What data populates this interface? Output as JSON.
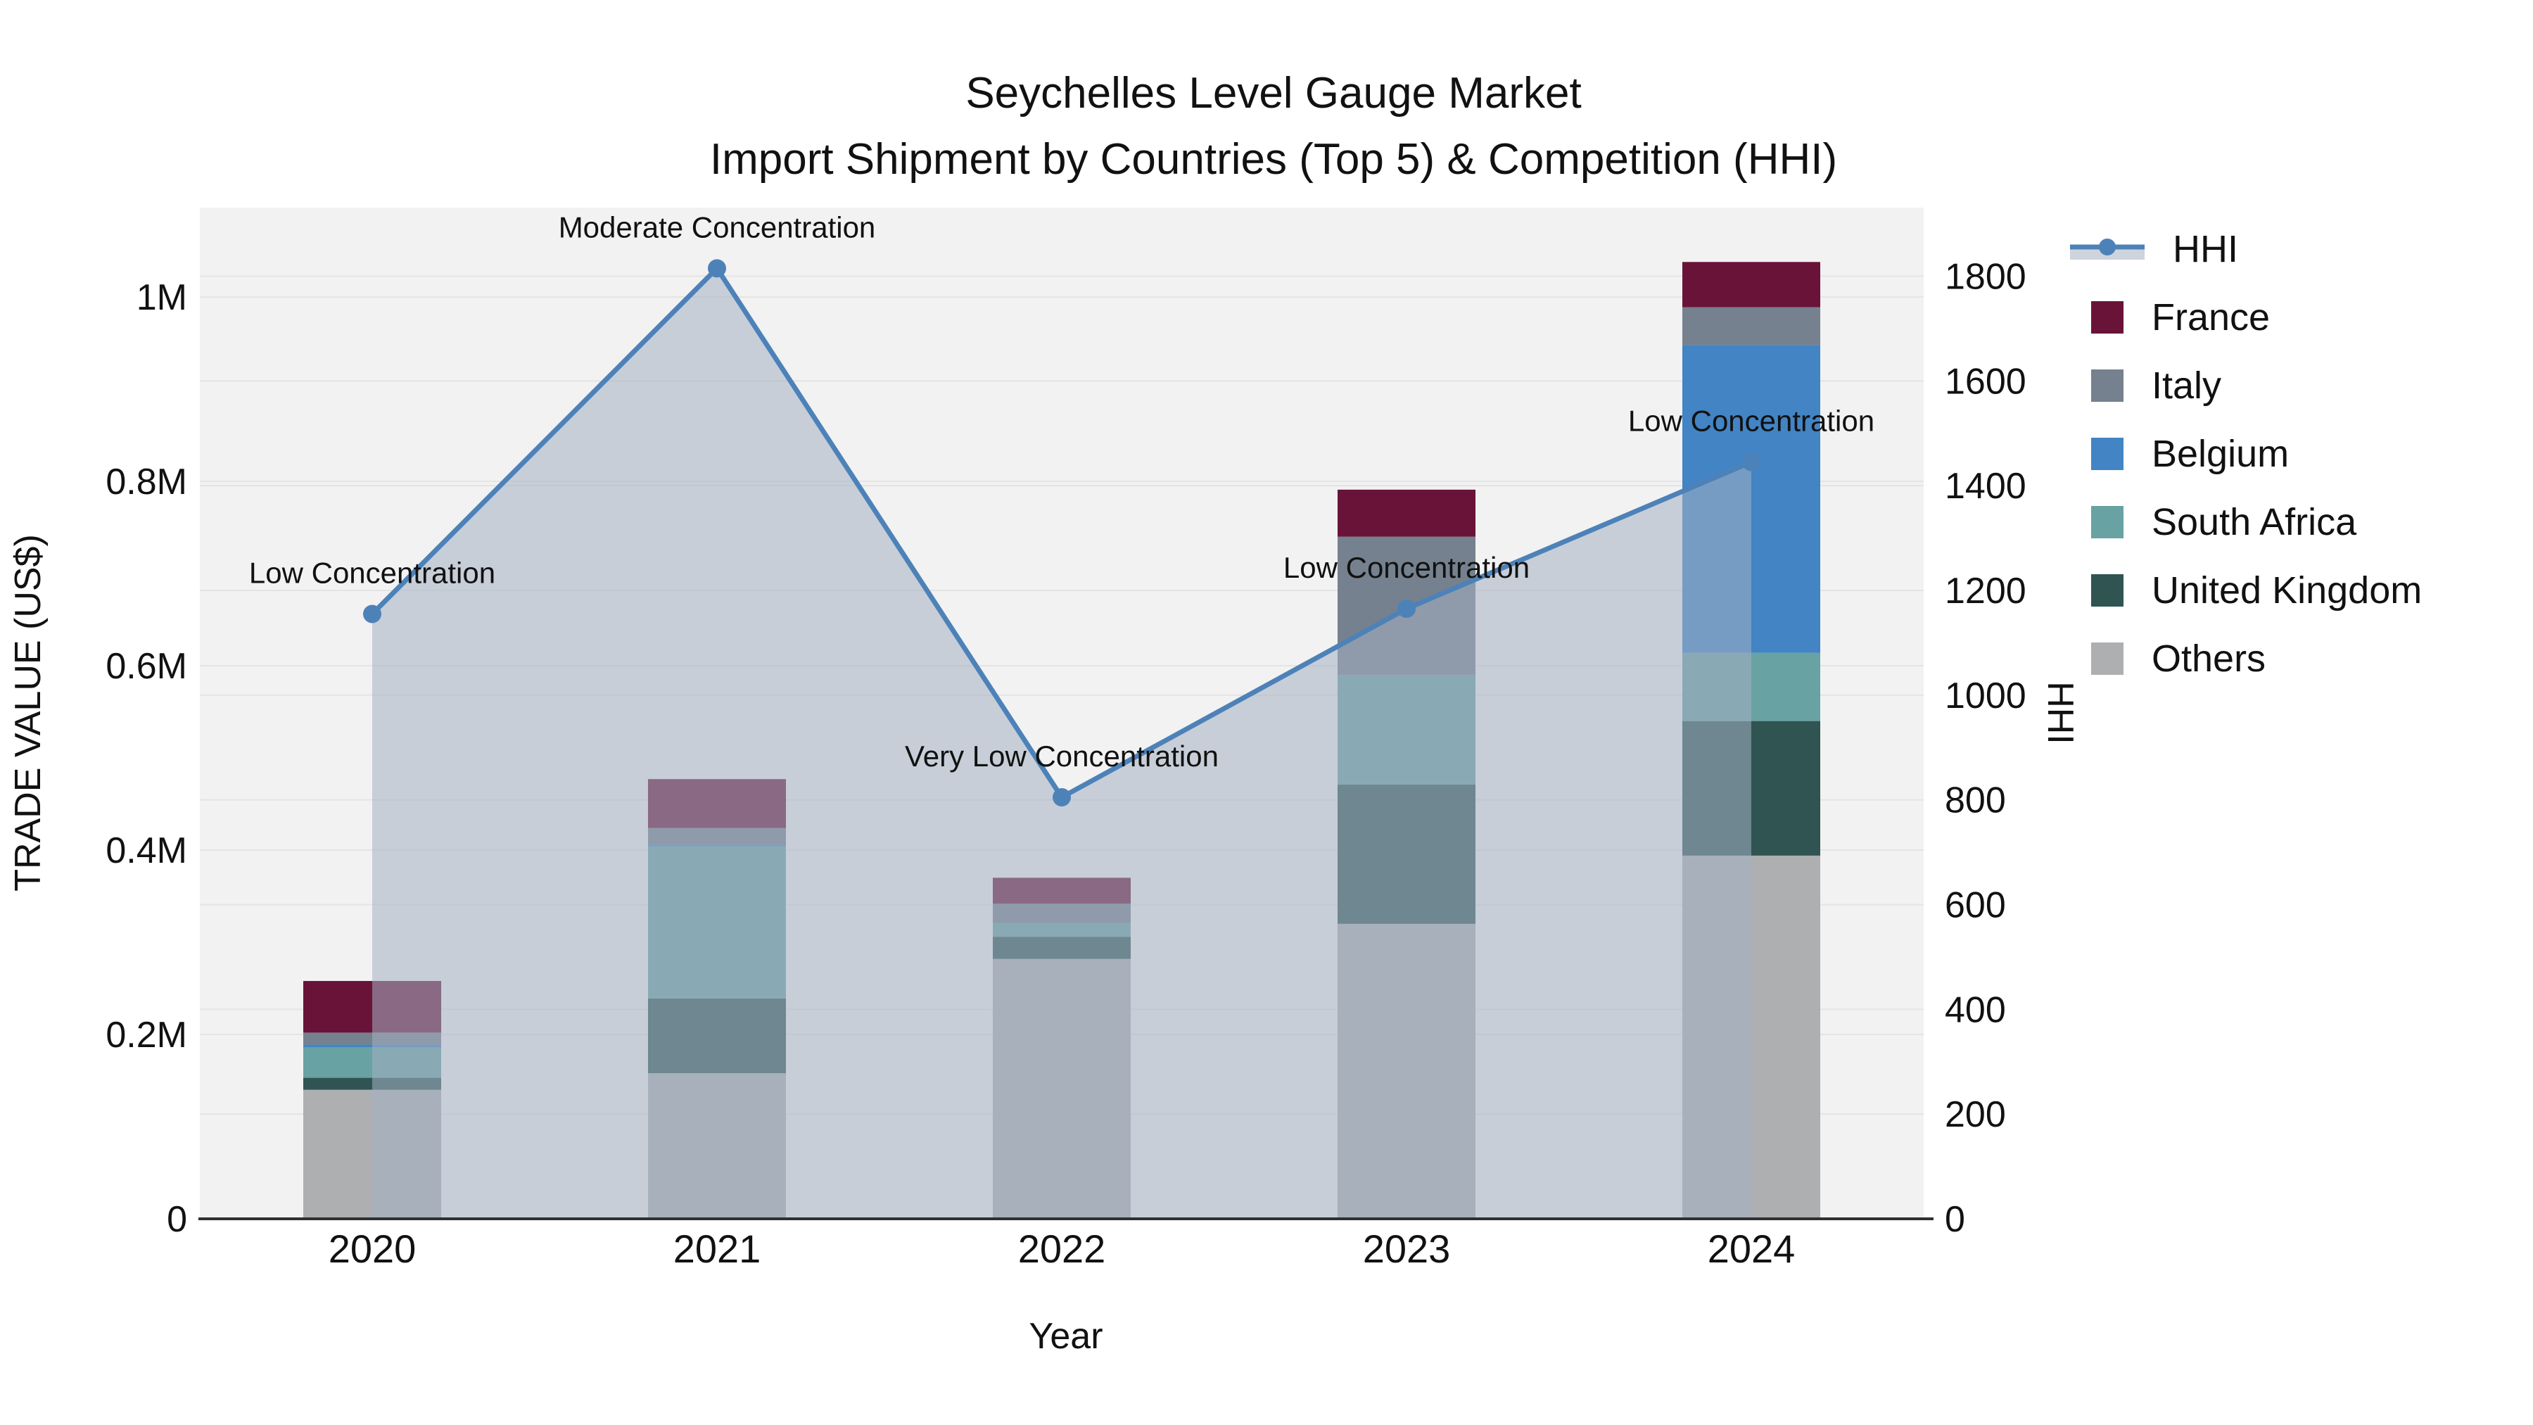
{
  "title": {
    "line1": "Seychelles Level Gauge Market",
    "line2": "Import Shipment by Countries (Top 5) & Competition (HHI)"
  },
  "colors": {
    "france": "#691338",
    "italy": "#75818e",
    "belgium": "#4284c4",
    "south_africa": "#68a2a3",
    "united_kingdom": "#2f5452",
    "others": "#adafb1",
    "hhi_line": "#4d82b8",
    "hhi_fill": "rgba(164,177,194,0.55)",
    "plot_background": "#f2f2f2",
    "grid": "#e4e4e4",
    "axis_line": "#303030",
    "text": "#111111"
  },
  "legend": {
    "entries": [
      {
        "label": "HHI",
        "type": "line"
      },
      {
        "label": "France",
        "type": "patch",
        "color": "#691338"
      },
      {
        "label": "Italy",
        "type": "patch",
        "color": "#75818e"
      },
      {
        "label": "Belgium",
        "type": "patch",
        "color": "#4284c4"
      },
      {
        "label": "South Africa",
        "type": "patch",
        "color": "#68a2a3"
      },
      {
        "label": "United Kingdom",
        "type": "patch",
        "color": "#2f5452"
      },
      {
        "label": "Others",
        "type": "patch",
        "color": "#adafb1"
      }
    ]
  },
  "chart_data": {
    "type": "combo-stacked-bar-line",
    "title": "Seychelles Level Gauge Market — Import Shipment by Countries (Top 5) & Competition (HHI)",
    "categories": [
      "2020",
      "2021",
      "2022",
      "2023",
      "2024"
    ],
    "bar_unit": "US$",
    "bar_stack_order_bottom_to_top": [
      "Others",
      "United Kingdom",
      "South Africa",
      "Belgium",
      "Italy",
      "France"
    ],
    "series": [
      {
        "name": "Others",
        "color": "#adafb1",
        "values": [
          140000,
          158000,
          282000,
          320000,
          394000
        ]
      },
      {
        "name": "United Kingdom",
        "color": "#2f5452",
        "values": [
          13000,
          81000,
          24000,
          151000,
          146000
        ]
      },
      {
        "name": "South Africa",
        "color": "#68a2a3",
        "values": [
          33000,
          165000,
          15000,
          119000,
          74000
        ]
      },
      {
        "name": "Belgium",
        "color": "#4284c4",
        "values": [
          3000,
          2000,
          0,
          0,
          334000
        ]
      },
      {
        "name": "Italy",
        "color": "#75818e",
        "values": [
          13000,
          18000,
          21000,
          150000,
          41000
        ]
      },
      {
        "name": "France",
        "color": "#691338",
        "values": [
          56000,
          53000,
          28000,
          51000,
          49000
        ]
      }
    ],
    "bar_totals": [
      258000,
      477000,
      370000,
      791000,
      1038000
    ],
    "line_series": {
      "name": "HHI",
      "values": [
        1155,
        1815,
        805,
        1165,
        1445
      ],
      "annotations": [
        "Low Concentration",
        "Moderate Concentration",
        "Very Low Concentration",
        "Low Concentration",
        "Low Concentration"
      ],
      "style": "line-with-markers-and-area-fill"
    },
    "xlabel": "Year",
    "y1": {
      "label": "TRADE VALUE (US$)",
      "ticks": [
        {
          "value": 0,
          "label": "0"
        },
        {
          "value": 200000,
          "label": "0.2M"
        },
        {
          "value": 400000,
          "label": "0.4M"
        },
        {
          "value": 600000,
          "label": "0.6M"
        },
        {
          "value": 800000,
          "label": "0.8M"
        },
        {
          "value": 1000000,
          "label": "1M"
        }
      ],
      "range": [
        0,
        1097000
      ]
    },
    "y2": {
      "label": "HHI",
      "ticks": [
        {
          "value": 0,
          "label": "0"
        },
        {
          "value": 200,
          "label": "200"
        },
        {
          "value": 400,
          "label": "400"
        },
        {
          "value": 600,
          "label": "600"
        },
        {
          "value": 800,
          "label": "800"
        },
        {
          "value": 1000,
          "label": "1000"
        },
        {
          "value": 1200,
          "label": "1200"
        },
        {
          "value": 1400,
          "label": "1400"
        },
        {
          "value": 1600,
          "label": "1600"
        },
        {
          "value": 1800,
          "label": "1800"
        }
      ],
      "range": [
        0,
        1931
      ]
    },
    "grid": true,
    "legend_position": "right-outside"
  }
}
